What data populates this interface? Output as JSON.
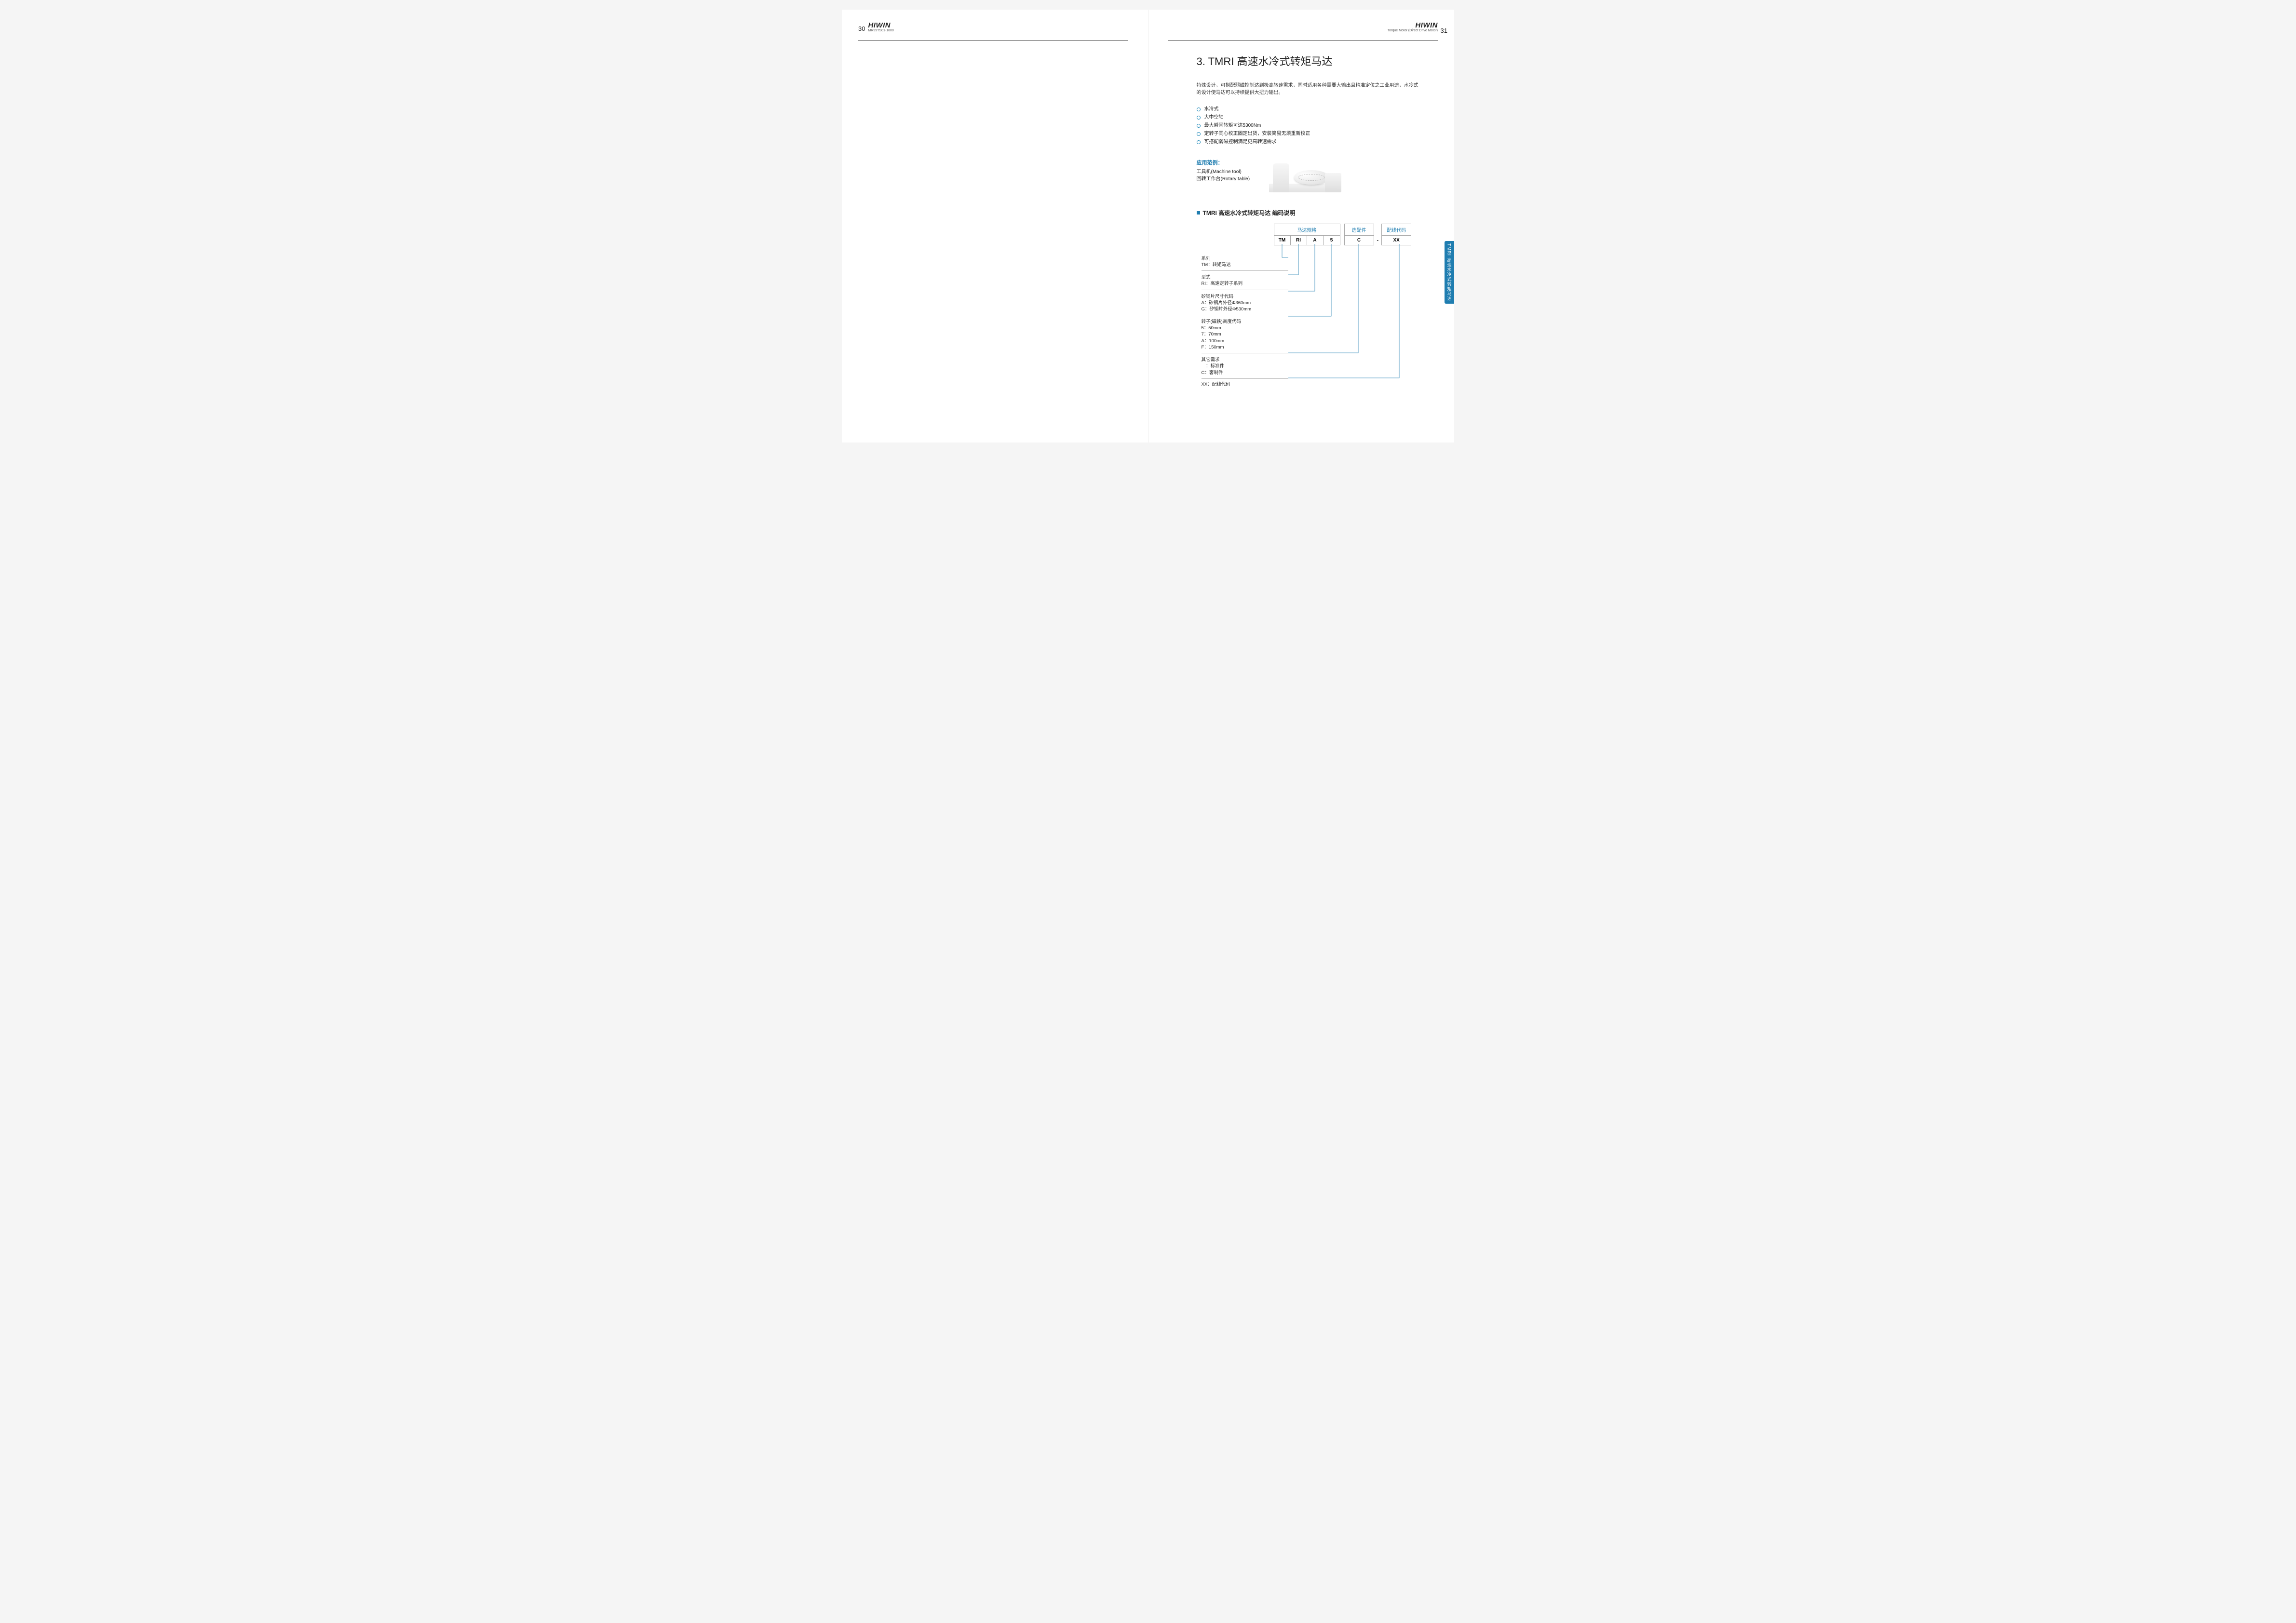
{
  "brand": "HIWIN",
  "left_page": {
    "number": "30",
    "subtitle": "MR99TS01-1800"
  },
  "right_page": {
    "number": "31",
    "subtitle": "Torque Motor (Direct Drive Motor)"
  },
  "title": "3. TMRI 高速水冷式转矩马达",
  "intro": "特殊设计，可搭配弱磁控制达到极高转速需求，同时适用各种需要大输出且精准定位之工业用途，水冷式的设计使马达可以持续提供大扭力输出。",
  "bullets": [
    "水冷式",
    "大中空轴",
    "最大瞬间转矩可达5300Nm",
    "定转子同心校正固定出货，安装简易无须重新校正",
    "可搭配弱磁控制满足更高转速需求"
  ],
  "applications": {
    "heading": "应用范例：",
    "items": [
      "工具机(Machine tool)",
      "回转工作台(Rotary table)"
    ]
  },
  "coding_section": {
    "heading": "TMRI 高速水冷式转矩马达 编码说明",
    "groups": [
      {
        "header": "马达规格",
        "cells": [
          "TM",
          "RI",
          "A",
          "5"
        ]
      },
      {
        "header": "选配件",
        "cells": [
          "C"
        ]
      }
    ],
    "separator": "-",
    "last_group": {
      "header": "配线代码",
      "cells": [
        "XX"
      ]
    }
  },
  "legend": [
    {
      "title": "系列",
      "lines": [
        "TM：转矩马达"
      ]
    },
    {
      "title": "型式",
      "lines": [
        "RI：高速定转子系列"
      ]
    },
    {
      "title": "矽钢片尺寸代码",
      "lines": [
        "A：矽钢片外径Φ360mm",
        "G：矽钢片外径Φ530mm"
      ]
    },
    {
      "title": "转子(磁铁)高度代码",
      "lines": [
        "5：50mm",
        "7：70mm",
        "A：100mm",
        "F：150mm"
      ]
    },
    {
      "title": "其它需求",
      "lines": [
        "　：标准件",
        "C：客制件"
      ]
    },
    {
      "title": "",
      "lines": [
        "XX：配线代码"
      ]
    }
  ],
  "side_tab": "TMRI 高速水冷式转矩马达"
}
